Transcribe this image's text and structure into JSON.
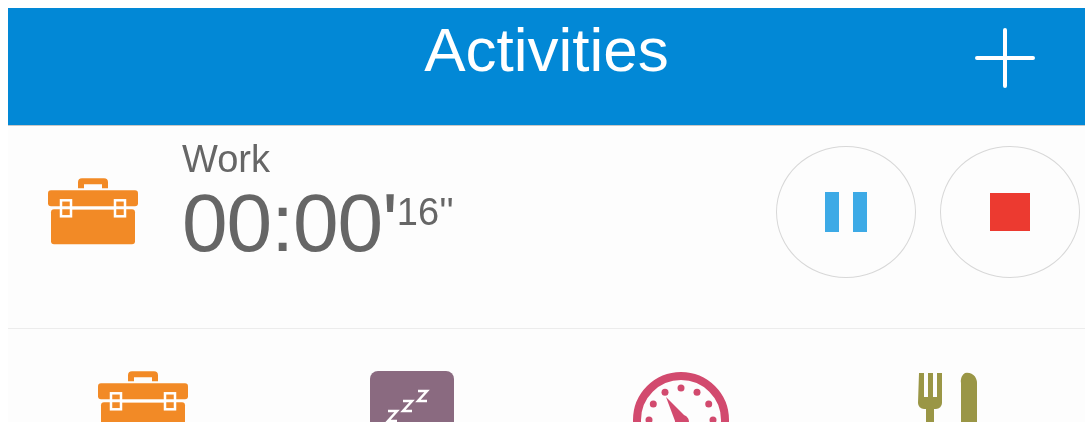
{
  "header": {
    "title": "Activities"
  },
  "current": {
    "name": "Work",
    "time": "00:00'",
    "seconds": "16''",
    "color": "#f28a26"
  },
  "categories": [
    {
      "kind": "work",
      "color": "#f28a26"
    },
    {
      "kind": "sleep",
      "color": "#8a6a80"
    },
    {
      "kind": "exercise",
      "color": "#d24a6e"
    },
    {
      "kind": "food",
      "color": "#9a9646"
    }
  ]
}
